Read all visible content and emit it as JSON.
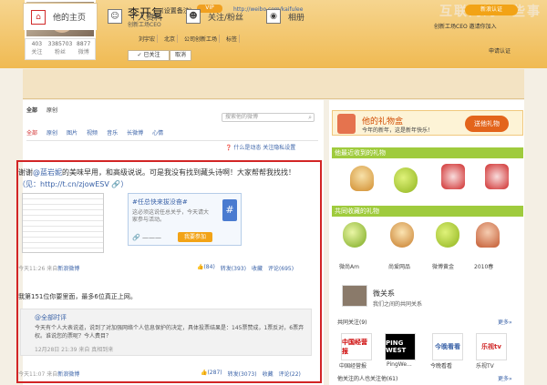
{
  "watermark": "互联网的一些事",
  "profile": {
    "name": "李开复",
    "remark": "(设置备注)",
    "vip": "VIP",
    "url": "http://weibo.com/kaifulee",
    "company": "创新工场CEO",
    "stats": [
      {
        "num": "403",
        "label": "关注"
      },
      {
        "num": "3385703",
        "label": "粉丝"
      },
      {
        "num": "8877",
        "label": "微博"
      }
    ],
    "tags": [
      "刘宇宏",
      "北京",
      "公司创新工场",
      "标签"
    ],
    "followed": "✓ 已关注",
    "cancel": "取消"
  },
  "top_right": {
    "verify": "新浪认证",
    "invite": "创新工场CEO 邀请你加入",
    "verify_link": "申请认证"
  },
  "tabs": [
    {
      "label": "他的主页",
      "icon": "home-icon"
    },
    {
      "label": "个人资料",
      "icon": "user-icon"
    },
    {
      "label": "关注/粉丝",
      "icon": "people-icon"
    },
    {
      "label": "相册",
      "icon": "camera-icon"
    }
  ],
  "main": {
    "subtabs": [
      "全部",
      "原创"
    ],
    "search_placeholder": "搜索他的微博",
    "filters": [
      "全部",
      "原创",
      "图片",
      "视频",
      "音乐",
      "长微博",
      "心情"
    ],
    "help": "❓ 什么是动态  关注隐私设置"
  },
  "post1": {
    "text_before": "谢谢",
    "mention": "@蓝岩妮",
    "text_after": "的美味早用，和高级说说。可是我没有找到藏头诗啊！大家帮帮我找找！",
    "link": "（见：http://t.cn/zjowESV 🔗）",
    "card_title": "#任总快来拔没奋#",
    "card_desc": "这必须这说任总关乎，今天请大家参与活动。",
    "card_btn": "我要参加",
    "card_link": "🔗 ———",
    "time": "今天11:26 来自",
    "source": "新浪微博",
    "actions": [
      "👍(84)",
      "转发(393)",
      "收藏",
      "评论(695)"
    ]
  },
  "post2": {
    "text": "我第151位你要里面，最多6位真正上网。",
    "repost_author": "@全部时评",
    "repost_text": "今天有个人大表说道，说到了对加强网络个人信息保护的决定，具体投票结果是：145票赞成，1票反对，6票弃权。谁说您的票呢？今人费目？",
    "repost_time": "12月28日 21:39 来自 真相到来",
    "time": "今天11:07 来自",
    "source": "新浪微博",
    "actions": [
      "👍(287)",
      "转发(3073)",
      "收藏",
      "评论(22)"
    ]
  },
  "sidebar": {
    "gift_title": "他的礼物盒",
    "gift_sub": "今年的新年，这是新年快乐！",
    "gift_btn": "送他礼物",
    "section1": "他最近收到的礼物",
    "section2": "共同收藏的礼物",
    "gift_labels": [
      "微尚Am",
      "尚爱网品",
      "微博黄金",
      "2010春"
    ],
    "relation_title": "微关系",
    "relation_sub": "我们之间的共同关系",
    "common_title": "共同关注(9)",
    "more": "更多»",
    "logos": [
      "PING WEST",
      "中国经营报",
      "今晚看看",
      "乐视tv"
    ],
    "logo_labels": [
      "中国经营报",
      "PingWe...",
      "今晚看看",
      "乐视TV"
    ],
    "bottom_title": "他关注的人也关注他(61)"
  }
}
